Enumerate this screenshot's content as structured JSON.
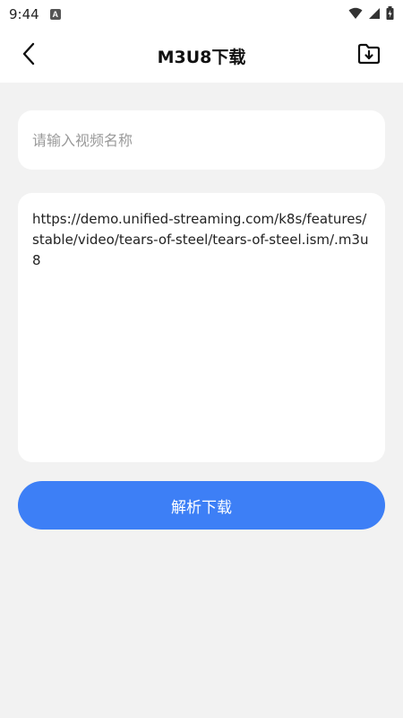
{
  "status_bar": {
    "time": "9:44",
    "notification_badge": "A",
    "icons": [
      "wifi-icon",
      "signal-icon",
      "battery-icon"
    ]
  },
  "app_bar": {
    "title": "M3U8下载",
    "back_icon": "back-arrow-icon",
    "action_icon": "folder-download-icon"
  },
  "form": {
    "name_placeholder": "请输入视频名称",
    "name_value": "",
    "url_value": "https://demo.unified-streaming.com/k8s/features/stable/video/tears-of-steel/tears-of-steel.ism/.m3u8",
    "submit_label": "解析下载"
  },
  "colors": {
    "background": "#f2f2f2",
    "accent": "#3d7ff6",
    "card": "#ffffff"
  }
}
